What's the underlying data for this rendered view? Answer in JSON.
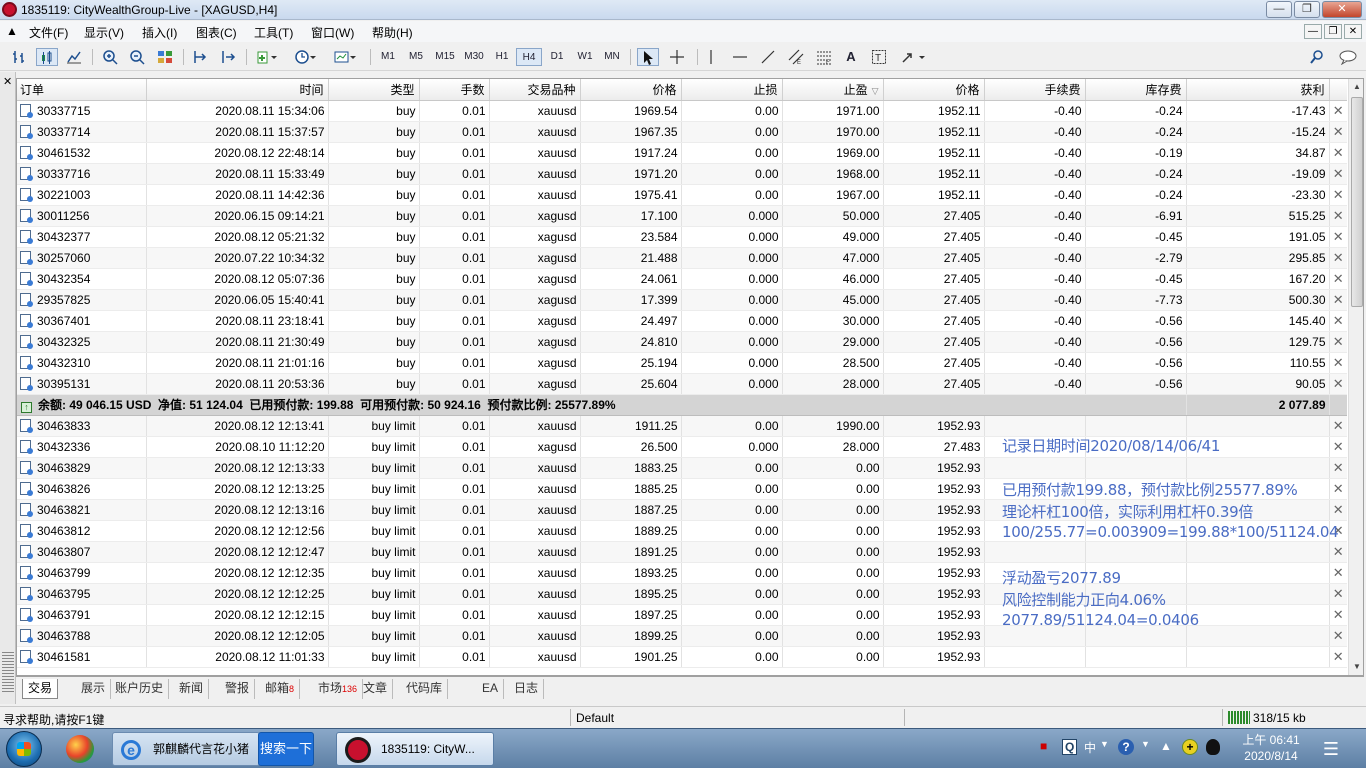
{
  "window": {
    "title": "1835119: CityWealthGroup-Live - [XAGUSD,H4]"
  },
  "menu": [
    "文件(F)",
    "显示(V)",
    "插入(I)",
    "图表(C)",
    "工具(T)",
    "窗口(W)",
    "帮助(H)"
  ],
  "toolbar": {
    "periods": [
      "M1",
      "M5",
      "M15",
      "M30",
      "H1",
      "H4",
      "D1",
      "W1",
      "MN"
    ],
    "active_period": "H4"
  },
  "columns": [
    "订单",
    "时间",
    "类型",
    "手数",
    "交易品种",
    "价格",
    "止损",
    "止盈",
    "价格",
    "手续费",
    "库存费",
    "获利"
  ],
  "open_positions": [
    [
      "30337715",
      "2020.08.11 15:34:06",
      "buy",
      "0.01",
      "xauusd",
      "1969.54",
      "0.00",
      "1971.00",
      "1952.11",
      "-0.40",
      "-0.24",
      "-17.43"
    ],
    [
      "30337714",
      "2020.08.11 15:37:57",
      "buy",
      "0.01",
      "xauusd",
      "1967.35",
      "0.00",
      "1970.00",
      "1952.11",
      "-0.40",
      "-0.24",
      "-15.24"
    ],
    [
      "30461532",
      "2020.08.12 22:48:14",
      "buy",
      "0.01",
      "xauusd",
      "1917.24",
      "0.00",
      "1969.00",
      "1952.11",
      "-0.40",
      "-0.19",
      "34.87"
    ],
    [
      "30337716",
      "2020.08.11 15:33:49",
      "buy",
      "0.01",
      "xauusd",
      "1971.20",
      "0.00",
      "1968.00",
      "1952.11",
      "-0.40",
      "-0.24",
      "-19.09"
    ],
    [
      "30221003",
      "2020.08.11 14:42:36",
      "buy",
      "0.01",
      "xauusd",
      "1975.41",
      "0.00",
      "1967.00",
      "1952.11",
      "-0.40",
      "-0.24",
      "-23.30"
    ],
    [
      "30011256",
      "2020.06.15 09:14:21",
      "buy",
      "0.01",
      "xagusd",
      "17.100",
      "0.000",
      "50.000",
      "27.405",
      "-0.40",
      "-6.91",
      "515.25"
    ],
    [
      "30432377",
      "2020.08.12 05:21:32",
      "buy",
      "0.01",
      "xagusd",
      "23.584",
      "0.000",
      "49.000",
      "27.405",
      "-0.40",
      "-0.45",
      "191.05"
    ],
    [
      "30257060",
      "2020.07.22 10:34:32",
      "buy",
      "0.01",
      "xagusd",
      "21.488",
      "0.000",
      "47.000",
      "27.405",
      "-0.40",
      "-2.79",
      "295.85"
    ],
    [
      "30432354",
      "2020.08.12 05:07:36",
      "buy",
      "0.01",
      "xagusd",
      "24.061",
      "0.000",
      "46.000",
      "27.405",
      "-0.40",
      "-0.45",
      "167.20"
    ],
    [
      "29357825",
      "2020.06.05 15:40:41",
      "buy",
      "0.01",
      "xagusd",
      "17.399",
      "0.000",
      "45.000",
      "27.405",
      "-0.40",
      "-7.73",
      "500.30"
    ],
    [
      "30367401",
      "2020.08.11 23:18:41",
      "buy",
      "0.01",
      "xagusd",
      "24.497",
      "0.000",
      "30.000",
      "27.405",
      "-0.40",
      "-0.56",
      "145.40"
    ],
    [
      "30432325",
      "2020.08.11 21:30:49",
      "buy",
      "0.01",
      "xagusd",
      "24.810",
      "0.000",
      "29.000",
      "27.405",
      "-0.40",
      "-0.56",
      "129.75"
    ],
    [
      "30432310",
      "2020.08.11 21:01:16",
      "buy",
      "0.01",
      "xagusd",
      "25.194",
      "0.000",
      "28.500",
      "27.405",
      "-0.40",
      "-0.56",
      "110.55"
    ],
    [
      "30395131",
      "2020.08.11 20:53:36",
      "buy",
      "0.01",
      "xagusd",
      "25.604",
      "0.000",
      "28.000",
      "27.405",
      "-0.40",
      "-0.56",
      "90.05"
    ]
  ],
  "summary": {
    "text": "余额: 49 046.15 USD  净值: 51 124.04  已用预付款: 199.88  可用预付款: 50 924.16  预付款比例: 25577.89%",
    "profit": "2 077.89"
  },
  "pending_orders": [
    [
      "30463833",
      "2020.08.12 12:13:41",
      "buy limit",
      "0.01",
      "xauusd",
      "1911.25",
      "0.00",
      "1990.00",
      "1952.93"
    ],
    [
      "30432336",
      "2020.08.10 11:12:20",
      "buy limit",
      "0.01",
      "xagusd",
      "26.500",
      "0.000",
      "28.000",
      "27.483"
    ],
    [
      "30463829",
      "2020.08.12 12:13:33",
      "buy limit",
      "0.01",
      "xauusd",
      "1883.25",
      "0.00",
      "0.00",
      "1952.93"
    ],
    [
      "30463826",
      "2020.08.12 12:13:25",
      "buy limit",
      "0.01",
      "xauusd",
      "1885.25",
      "0.00",
      "0.00",
      "1952.93"
    ],
    [
      "30463821",
      "2020.08.12 12:13:16",
      "buy limit",
      "0.01",
      "xauusd",
      "1887.25",
      "0.00",
      "0.00",
      "1952.93"
    ],
    [
      "30463812",
      "2020.08.12 12:12:56",
      "buy limit",
      "0.01",
      "xauusd",
      "1889.25",
      "0.00",
      "0.00",
      "1952.93"
    ],
    [
      "30463807",
      "2020.08.12 12:12:47",
      "buy limit",
      "0.01",
      "xauusd",
      "1891.25",
      "0.00",
      "0.00",
      "1952.93"
    ],
    [
      "30463799",
      "2020.08.12 12:12:35",
      "buy limit",
      "0.01",
      "xauusd",
      "1893.25",
      "0.00",
      "0.00",
      "1952.93"
    ],
    [
      "30463795",
      "2020.08.12 12:12:25",
      "buy limit",
      "0.01",
      "xauusd",
      "1895.25",
      "0.00",
      "0.00",
      "1952.93"
    ],
    [
      "30463791",
      "2020.08.12 12:12:15",
      "buy limit",
      "0.01",
      "xauusd",
      "1897.25",
      "0.00",
      "0.00",
      "1952.93"
    ],
    [
      "30463788",
      "2020.08.12 12:12:05",
      "buy limit",
      "0.01",
      "xauusd",
      "1899.25",
      "0.00",
      "0.00",
      "1952.93"
    ],
    [
      "30461581",
      "2020.08.12 11:01:33",
      "buy limit",
      "0.01",
      "xauusd",
      "1901.25",
      "0.00",
      "0.00",
      "1952.93"
    ]
  ],
  "annotations": [
    "记录日期时间2020/08/14/06/41",
    "已用预付款199.88，预付款比例25577.89%",
    "理论杆杠100倍，实际利用杠杆0.39倍",
    "100/255.77=0.003909=199.88*100/51124.04",
    "浮动盈亏2077.89",
    "风险控制能力正向4.06%",
    "2077.89/51124.04=0.0406"
  ],
  "tabs": [
    {
      "label": "交易",
      "badge": ""
    },
    {
      "label": "展示",
      "badge": ""
    },
    {
      "label": "账户历史",
      "badge": ""
    },
    {
      "label": "新闻",
      "badge": ""
    },
    {
      "label": "警报",
      "badge": ""
    },
    {
      "label": "邮箱",
      "badge": "8"
    },
    {
      "label": "市场",
      "badge": "136"
    },
    {
      "label": "文章",
      "badge": ""
    },
    {
      "label": "代码库",
      "badge": ""
    },
    {
      "label": "EA",
      "badge": ""
    },
    {
      "label": "日志",
      "badge": ""
    }
  ],
  "active_tab": "交易",
  "status": {
    "help": "寻求帮助,请按F1键",
    "profile": "Default",
    "traffic": "318/15 kb"
  },
  "taskbar": {
    "ie_item": "郭麒麟代言花小猪",
    "search_button": "搜索一下",
    "mt_item": "1835119: CityW...",
    "lang": "中",
    "time": "上午 06:41",
    "date": "2020/8/14"
  }
}
